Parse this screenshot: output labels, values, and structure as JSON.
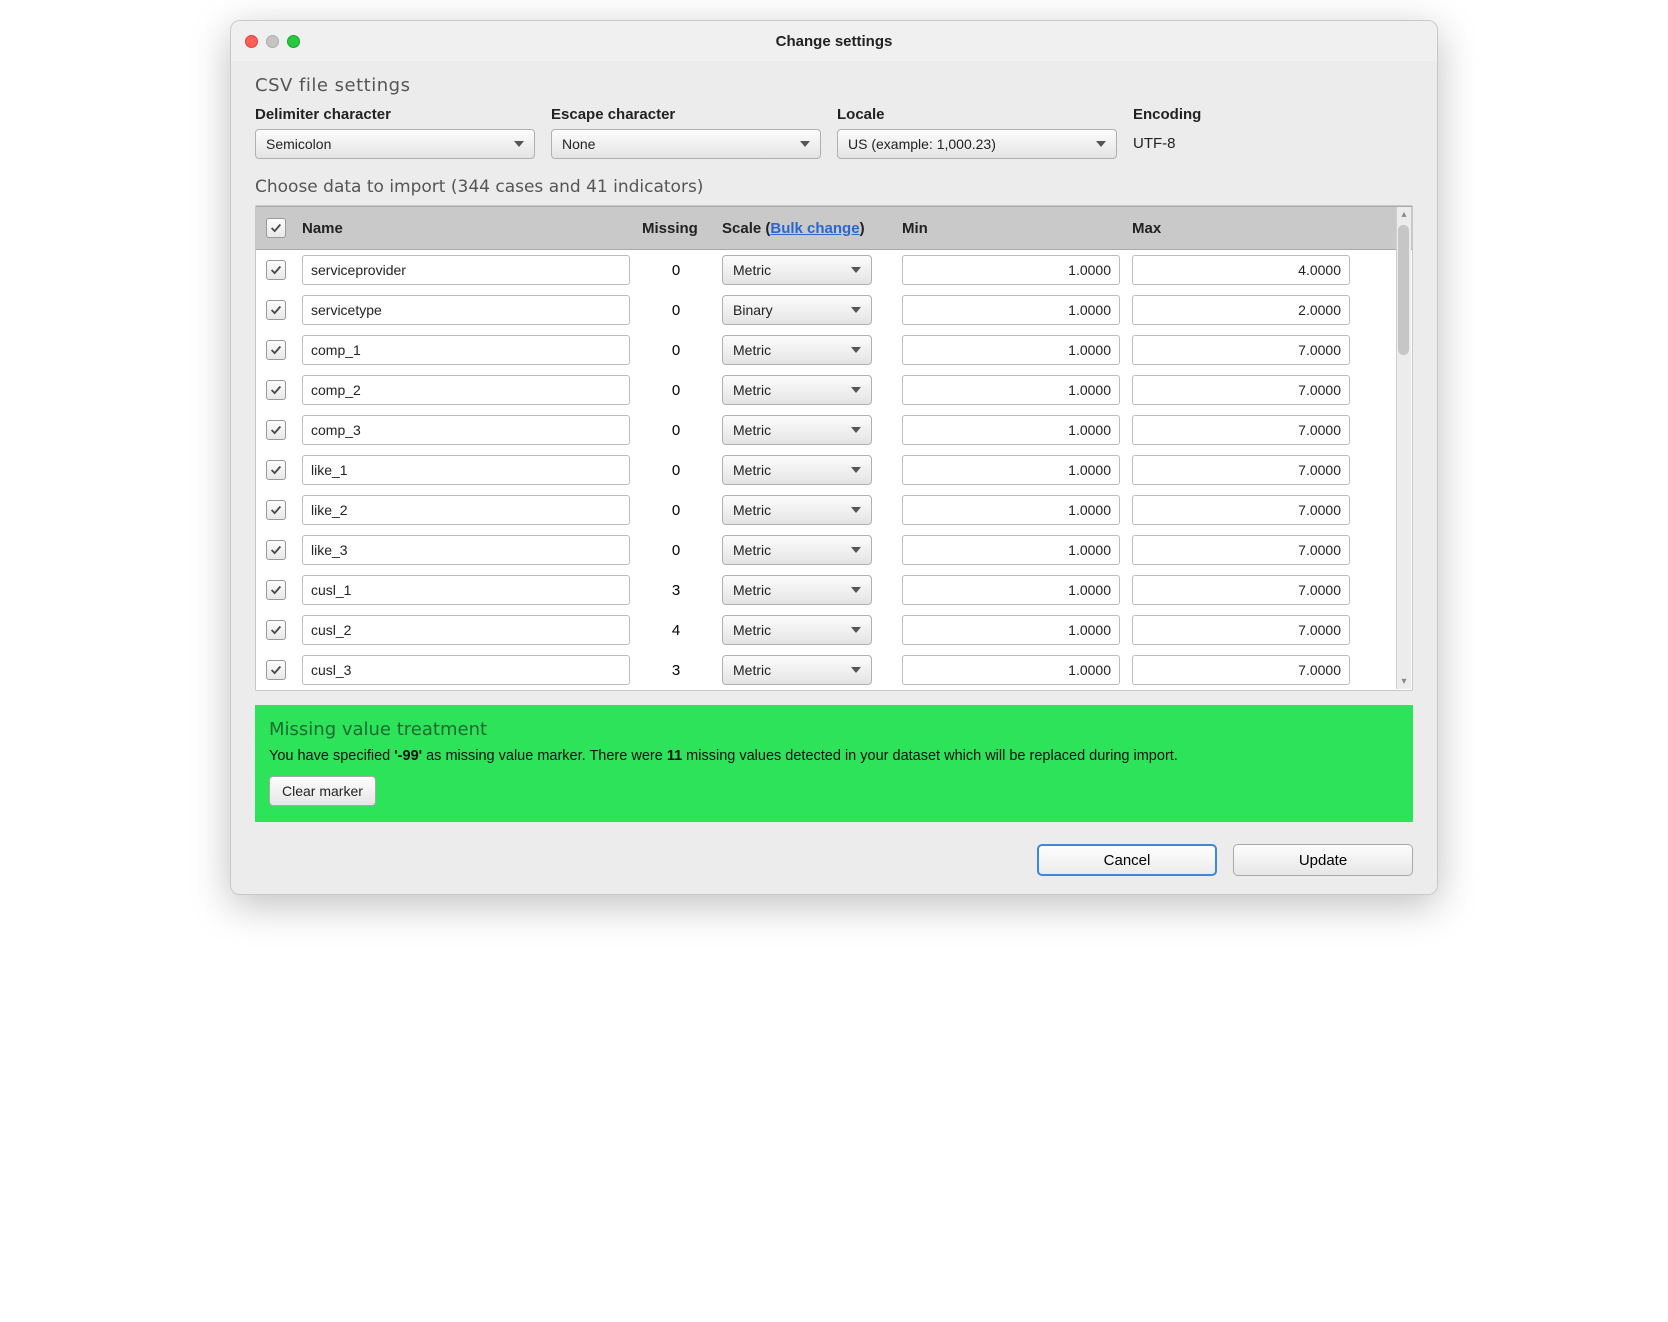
{
  "window": {
    "title": "Change settings"
  },
  "section": {
    "csv_label": "CSV file settings",
    "choose_label": "Choose data to import (344 cases and 41 indicators)"
  },
  "csv": {
    "delimiter_label": "Delimiter character",
    "delimiter_value": "Semicolon",
    "escape_label": "Escape character",
    "escape_value": "None",
    "locale_label": "Locale",
    "locale_value": "US (example: 1,000.23)",
    "encoding_label": "Encoding",
    "encoding_value": "UTF-8"
  },
  "table": {
    "headers": {
      "name": "Name",
      "missing": "Missing",
      "scale_prefix": "Scale (",
      "bulk_link": "Bulk change",
      "scale_suffix": ")",
      "min": "Min",
      "max": "Max"
    },
    "rows": [
      {
        "name": "serviceprovider",
        "missing": "0",
        "scale": "Metric",
        "min": "1.0000",
        "max": "4.0000"
      },
      {
        "name": "servicetype",
        "missing": "0",
        "scale": "Binary",
        "min": "1.0000",
        "max": "2.0000"
      },
      {
        "name": "comp_1",
        "missing": "0",
        "scale": "Metric",
        "min": "1.0000",
        "max": "7.0000"
      },
      {
        "name": "comp_2",
        "missing": "0",
        "scale": "Metric",
        "min": "1.0000",
        "max": "7.0000"
      },
      {
        "name": "comp_3",
        "missing": "0",
        "scale": "Metric",
        "min": "1.0000",
        "max": "7.0000"
      },
      {
        "name": "like_1",
        "missing": "0",
        "scale": "Metric",
        "min": "1.0000",
        "max": "7.0000"
      },
      {
        "name": "like_2",
        "missing": "0",
        "scale": "Metric",
        "min": "1.0000",
        "max": "7.0000"
      },
      {
        "name": "like_3",
        "missing": "0",
        "scale": "Metric",
        "min": "1.0000",
        "max": "7.0000"
      },
      {
        "name": "cusl_1",
        "missing": "3",
        "scale": "Metric",
        "min": "1.0000",
        "max": "7.0000"
      },
      {
        "name": "cusl_2",
        "missing": "4",
        "scale": "Metric",
        "min": "1.0000",
        "max": "7.0000"
      },
      {
        "name": "cusl_3",
        "missing": "3",
        "scale": "Metric",
        "min": "1.0000",
        "max": "7.0000"
      }
    ]
  },
  "missing_panel": {
    "title": "Missing value treatment",
    "text_pre": "You have specified ",
    "marker": "'-99'",
    "text_mid": " as missing value marker. There were ",
    "count": "11",
    "text_post": " missing values detected in your dataset which will be replaced during import.",
    "clear_label": "Clear marker"
  },
  "footer": {
    "cancel": "Cancel",
    "update": "Update"
  }
}
